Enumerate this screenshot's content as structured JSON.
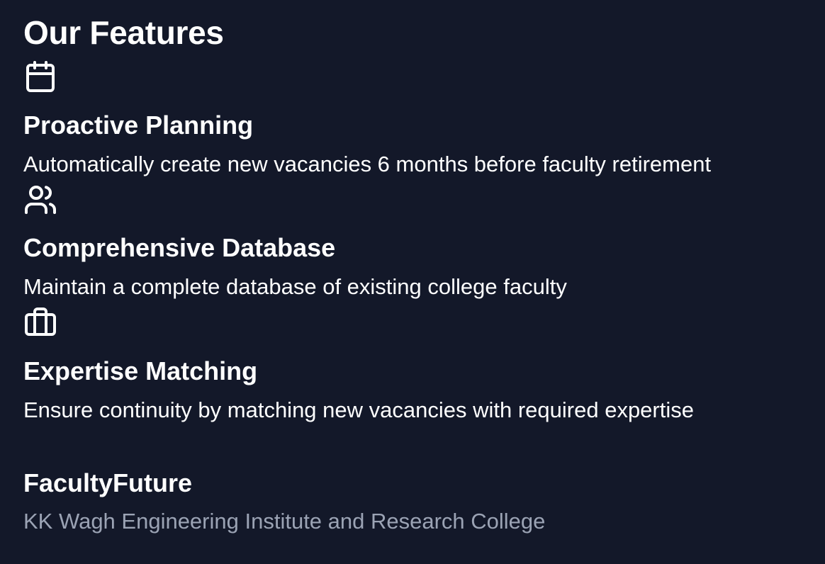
{
  "features": {
    "heading": "Our Features",
    "items": [
      {
        "icon": "calendar-icon",
        "title": "Proactive Planning",
        "description": "Automatically create new vacancies 6 months before faculty retirement"
      },
      {
        "icon": "users-icon",
        "title": "Comprehensive Database",
        "description": "Maintain a complete database of existing college faculty"
      },
      {
        "icon": "briefcase-icon",
        "title": "Expertise Matching",
        "description": "Ensure continuity by matching new vacancies with required expertise"
      }
    ]
  },
  "footer": {
    "brand": "FacultyFuture",
    "institution": "KK Wagh Engineering Institute and Research College"
  },
  "colors": {
    "background": "#131829",
    "text": "#ffffff",
    "muted_text": "#9ba3b4"
  }
}
